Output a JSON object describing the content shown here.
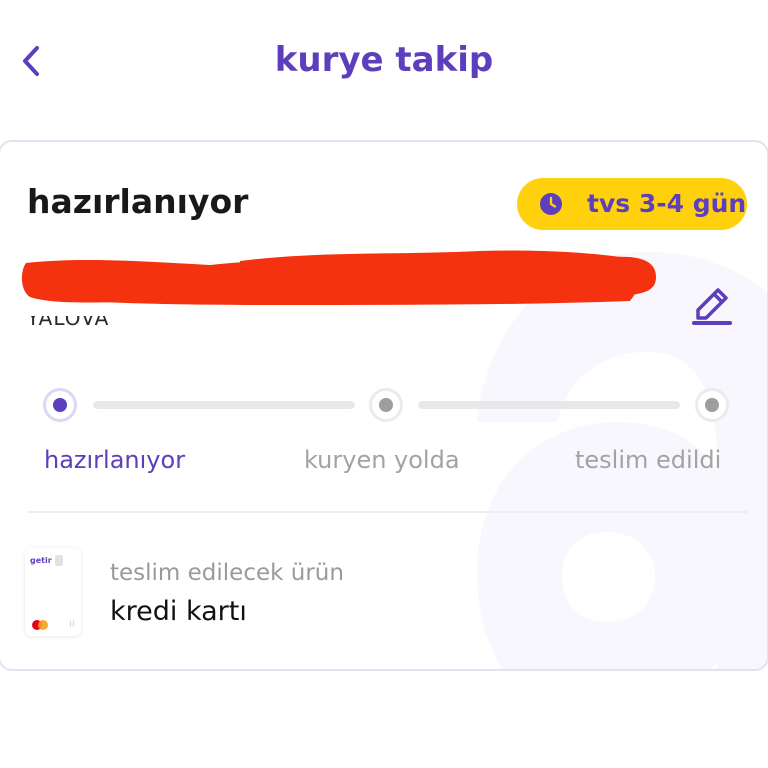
{
  "header": {
    "back_icon": "chevron-left-icon",
    "title": "kurye takip"
  },
  "status": {
    "title": "hazırlanıyor",
    "eta_icon": "clock-icon",
    "eta_text": "tvs 3-4 gün"
  },
  "address": {
    "visible_fragment": "YALOVA",
    "redacted": true,
    "edit_icon": "pencil-icon"
  },
  "progress": {
    "current_step": 0,
    "steps": [
      {
        "label": "hazırlanıyor",
        "state": "active"
      },
      {
        "label": "kuryen yolda",
        "state": "pending"
      },
      {
        "label": "teslim edildi",
        "state": "pending"
      }
    ]
  },
  "product": {
    "caption": "teslim edilecek ürün",
    "name": "kredi kartı",
    "thumbnail_brand": "getir"
  },
  "colors": {
    "brand_purple": "#5d3ebc",
    "badge_yellow": "#ffd10d",
    "redaction_red": "#f5320f",
    "pending_grey": "#9e9e9e"
  }
}
